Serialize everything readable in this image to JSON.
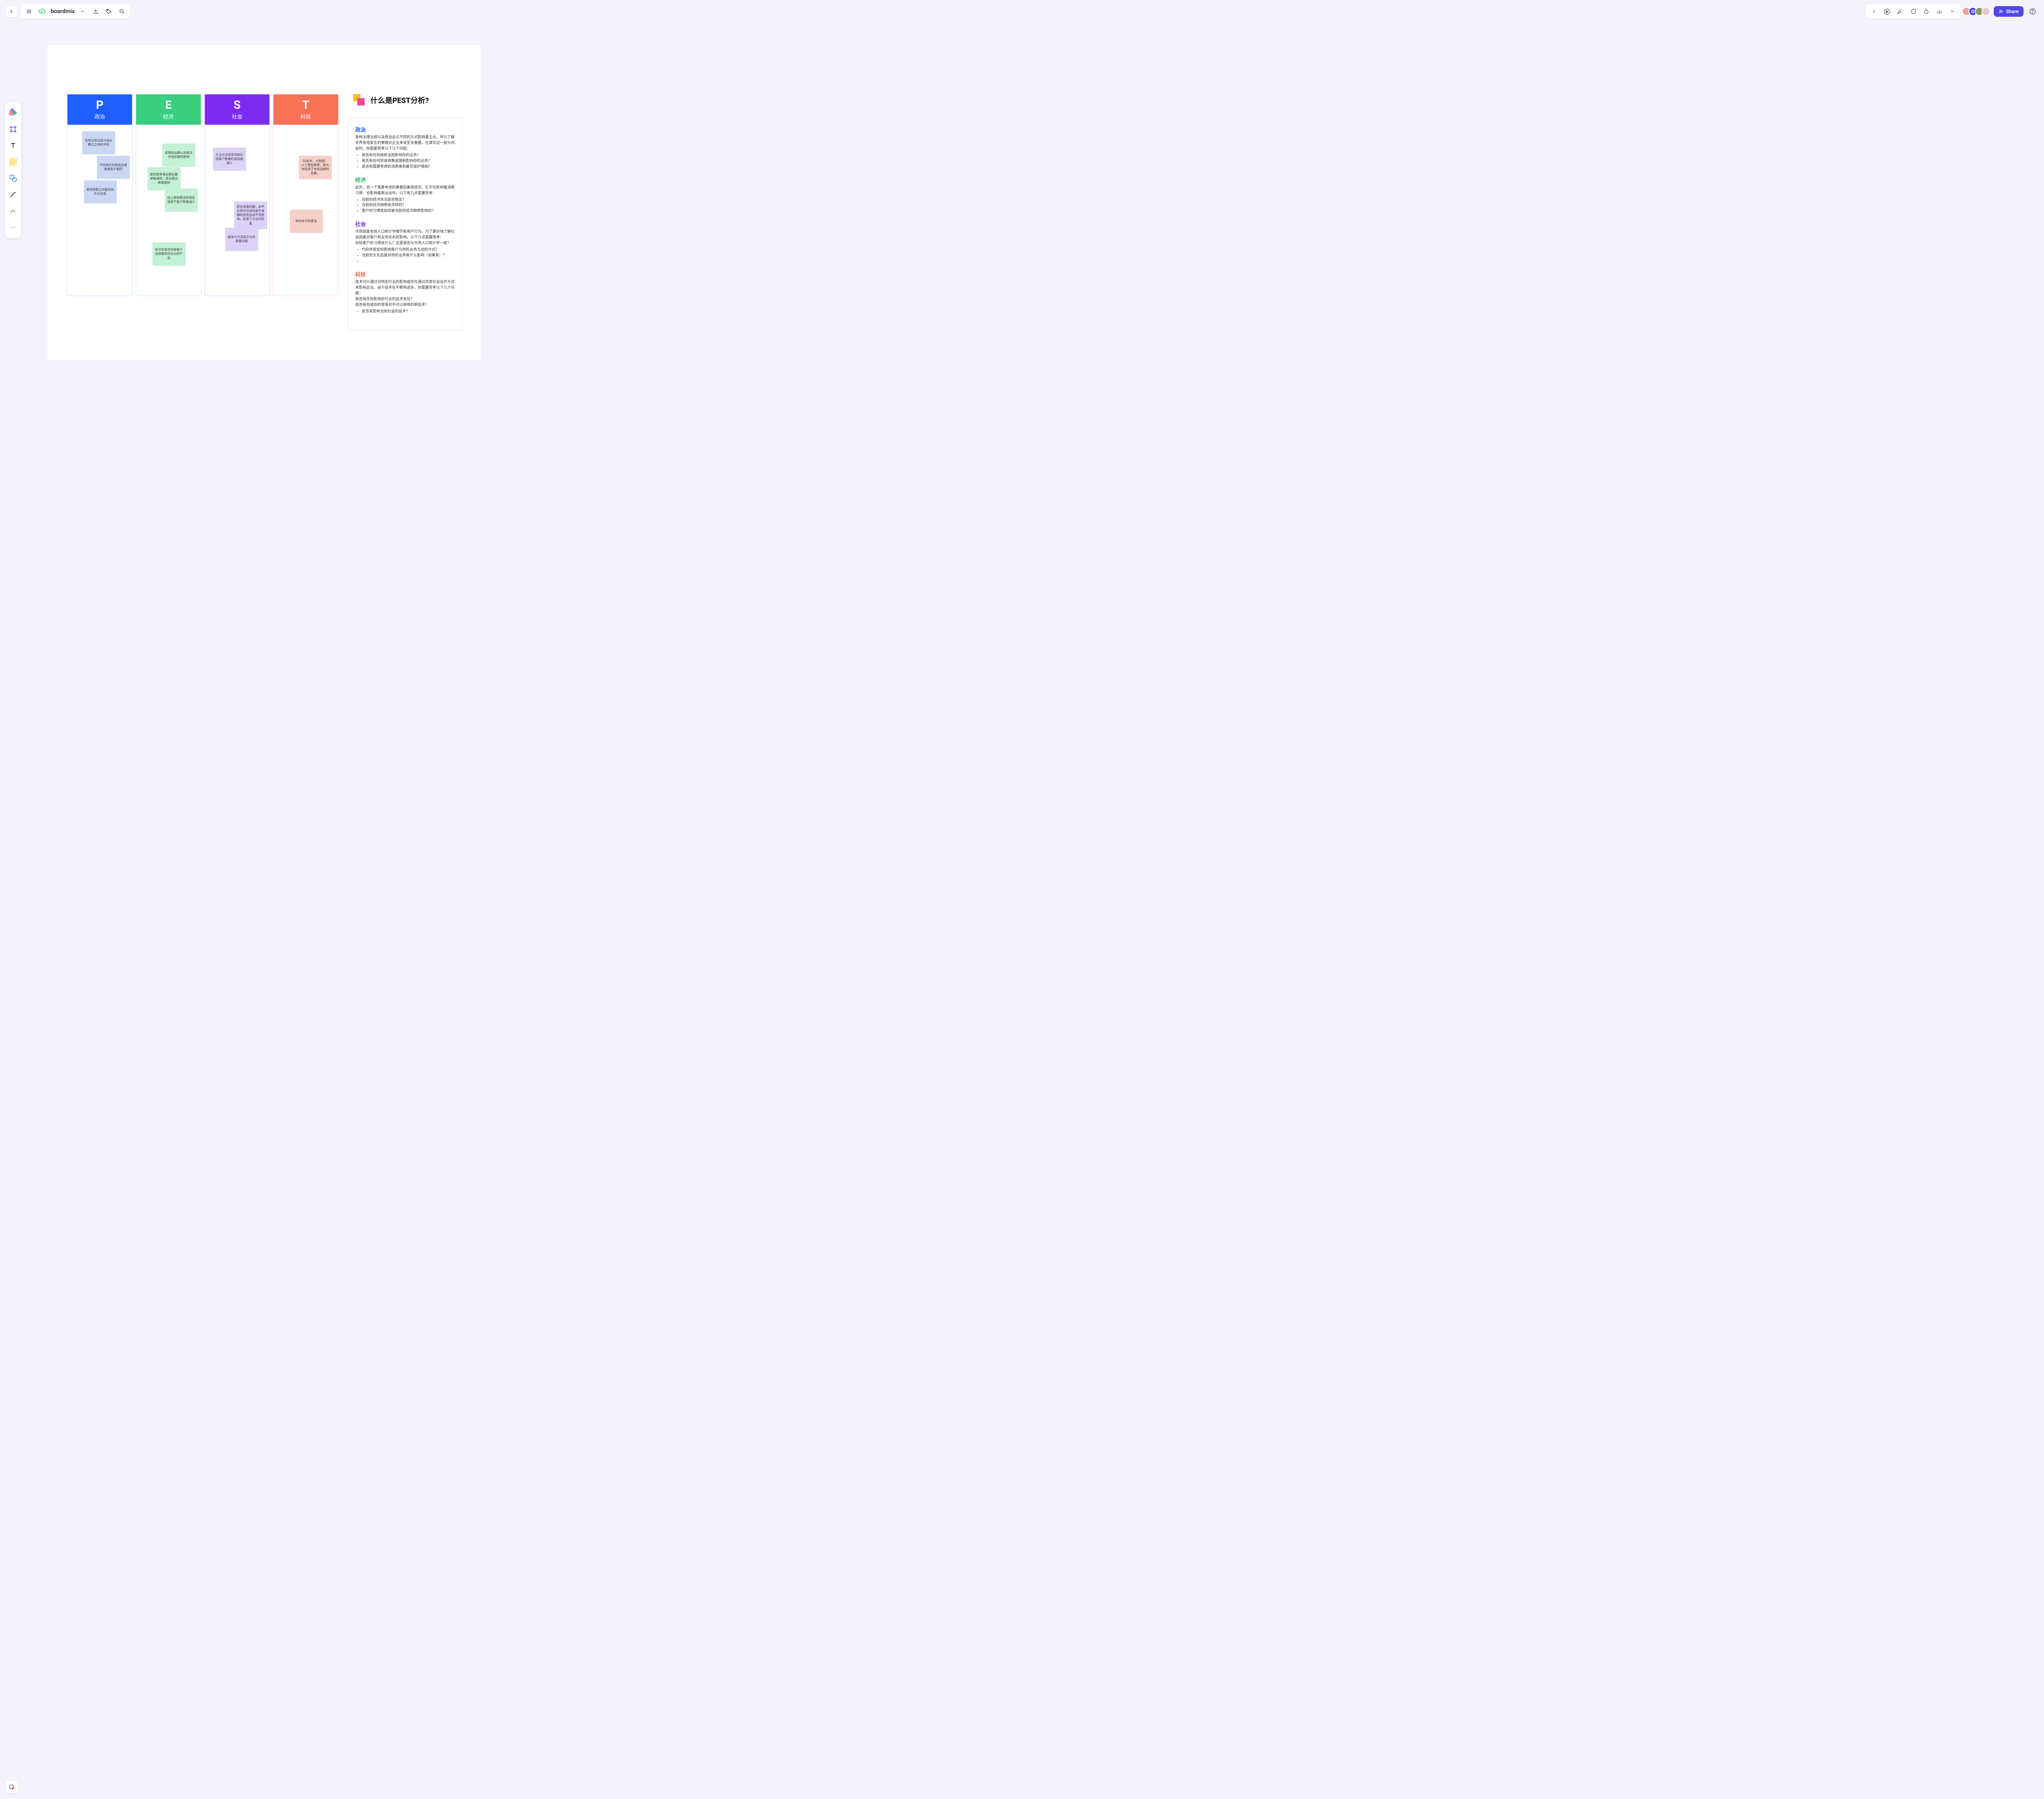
{
  "header": {
    "doc_title": "boardmix",
    "share_label": "Share",
    "avatars": [
      {
        "initial": "",
        "bg": "#f0a09a"
      },
      {
        "initial": "O",
        "bg": "#4f46e5",
        "fg": "#ffffff"
      },
      {
        "initial": "",
        "bg": "#8a9a6a"
      },
      {
        "initial": "",
        "bg": "#e6c7d0"
      }
    ]
  },
  "columns": {
    "p": {
      "letter": "P",
      "label": "政治"
    },
    "e": {
      "letter": "E",
      "label": "经济"
    },
    "s": {
      "letter": "S",
      "label": "社会"
    },
    "t": {
      "letter": "T",
      "label": "科技"
    }
  },
  "notes": {
    "p1": "当地法律法规与商业模式之间的冲突",
    "p2": "不同地区的税收法规难易各不相同",
    "p3": "某些国家之间复杂的外交关系",
    "e1": "疫情的品牌认知度对市场份额的影响",
    "e2": "新的竞争者如雨后春笋般涌现，商业模式易被复制",
    "e3": "线上购物需求的增加使得下客户数量减少",
    "e4": "经济的衰退导致客户选择更具性价比的产品",
    "s1": "生活方式改变导致在线客户数量的增加或减少",
    "s2": "职业道德问题，如不负责任的采购或不准确的信息造成不良影响，危害了企业的形象",
    "s3": "媒体大力渲染企业的质量问题",
    "t1": "5G技术，大数据，人工智能等等，极大地促进了电商消费的发展。",
    "t2": "移动支付的普及"
  },
  "explain": {
    "title": "什么是PEST分析?",
    "political": {
      "heading": "政治",
      "intro": "各种法律法规以及政治会以不同的方式影响着企业。所以了解世界各地发生的事情对企业来说至关重要。在填写这一部分内容时，你需要思考以下几个问题：",
      "b1": "是否有任何政府法规影响你的业务？",
      "b2": "是否有任何贸易政策或限制影响你的业务？",
      "b3": "是否有需要考虑的消费者和雇员保护措施？"
    },
    "economic": {
      "heading": "经济",
      "intro": "此外，另一个需要考虑的重要因素是经济。它不仅影响着消费习惯，也影响着商业运作。以下有几点需要思考：",
      "b1": "目前的经济状况是否稳定？",
      "b2": "当前的经济趋势是怎样的？",
      "b3": "客户的习惯是如何被当前的经济趋势影响的？"
    },
    "social": {
      "heading": "社会",
      "intro": "市场调查包括人口统计学细节和用户行为。为了更好地了解社会因素对客户和业务关系的影响，以下几点需要思考：",
      "l1": "目标客户的习惯是什么？这里是否与市场人口统计学一致？",
      "b1": "代际转变如何影响客户与你的业务互动的方式？",
      "b2": "当前的文化态度对你的业务有什么影响（如果有）？",
      "b3": ""
    },
    "tech": {
      "heading": "科技",
      "intro": "技术可以通过对特定行业的影响或仅仅通过改变社会运作方式来影响企业。由于技术在不断地进步，你需要思考以下几个问题：",
      "l1": "是否有任何影响你行业的技术变化？",
      "l2": "是否有你或你的竞争对手可以使用的新技术？",
      "b1": "是否有影响当前社会的技术？"
    }
  }
}
